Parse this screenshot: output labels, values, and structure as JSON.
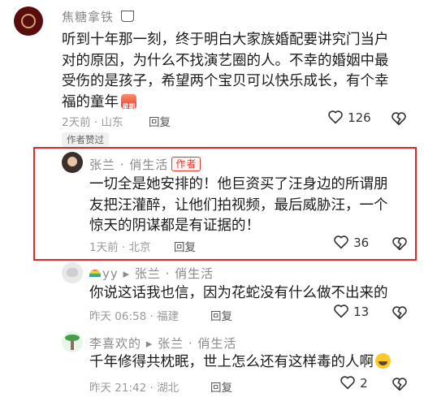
{
  "comments": [
    {
      "username": "焦糖拿铁",
      "text": [
        "听到十年那一刻，终于明白大家族婚配要讲究门当户",
        "对的原因，为什么不找演艺圈的人。不幸的婚姻中最",
        "受伤的是孩子，希望两个宝贝可以快乐成长，有个幸",
        "福的童年"
      ],
      "emoji_badge": "星期",
      "time": "2天前 · 山东",
      "reply": "回复",
      "likes": "126",
      "chip": "作者赞过"
    },
    {
      "username": "张兰 · 俏生活",
      "author_tag": "作者",
      "text": [
        "一切全是她安排的！他巨资买了汪身边的所谓朋",
        "友把汪灌醉，让他们拍视频，最后威胁汪，一个",
        "惊天的阴谋都是有证据的！"
      ],
      "time": "1天前 · 北京",
      "reply": "回复",
      "likes": "36"
    },
    {
      "username": "yy ▸ 张兰 · 俏生活",
      "text": [
        "你说这话我也信，因为花蛇没有什么做不出来的"
      ],
      "time": "昨天 06:58 · 福建",
      "reply": "回复",
      "likes": "13"
    },
    {
      "username": "李喜欢的 ▸ 张兰 · 俏生活",
      "text": [
        "千年修得共枕眠，世上怎么还有这样毒的人啊"
      ],
      "time": "昨天 21:42 · 湖北",
      "reply": "回复",
      "likes": "2"
    }
  ],
  "colors": {
    "highlight": "#e12828",
    "author": "#e53935",
    "text": "#1b1b1b",
    "meta": "#9a9a9a"
  },
  "icons": [
    "heart-icon",
    "broken-heart-icon",
    "coffee-cup-icon",
    "rainbow-icon",
    "palm-tree-icon"
  ]
}
